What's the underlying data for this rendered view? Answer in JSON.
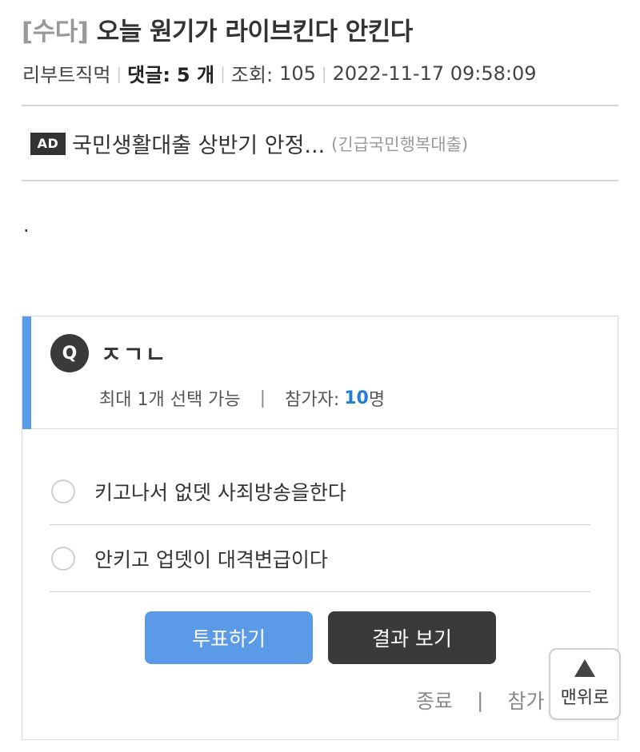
{
  "post": {
    "tag": "[수다]",
    "title": "오늘 원기가 라이브킨다 안킨다",
    "author": "리부트직먹",
    "comments_label": "댓글:",
    "comments_count": "5 개",
    "views_label": "조회:",
    "views": "105",
    "datetime": "2022-11-17 09:58:09",
    "body": "."
  },
  "ad": {
    "badge": "AD",
    "text": "국민생활대출 상반기 안정...",
    "source": "(긴급국민행복대출)"
  },
  "poll": {
    "q_badge": "Q",
    "question": "ㅈㄱㄴ",
    "max_select": "최대 1개 선택 가능",
    "divider": "|",
    "participants_label": "참가자:",
    "participants_count": "10",
    "participants_unit": "명",
    "options": [
      {
        "label": "키고나서 없뎃 사죄방송을한다",
        "selected": false
      },
      {
        "label": "안키고 업뎃이 대격변급이다",
        "selected": false
      }
    ],
    "vote_button": "투표하기",
    "result_button": "결과 보기",
    "close_label": "종료",
    "participate_label": "참가"
  },
  "scroll_top": {
    "label": "맨위로"
  },
  "colors": {
    "accent": "#5b9ae6",
    "dark": "#3a3a3a",
    "count": "#1e7fd8"
  }
}
